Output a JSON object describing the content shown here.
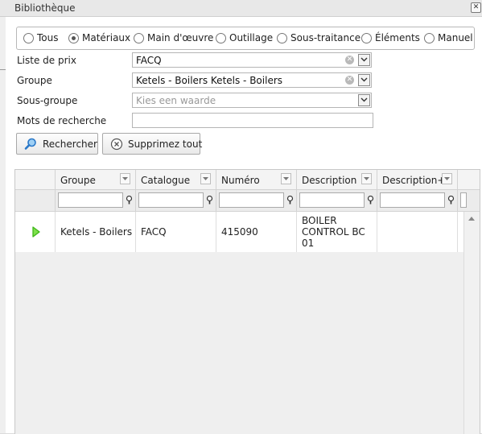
{
  "window": {
    "title": "Bibliothèque",
    "close_glyph": "✕"
  },
  "categories": [
    {
      "label": "Tous",
      "checked": false
    },
    {
      "label": "Matériaux",
      "checked": true
    },
    {
      "label": "Main d'œuvre",
      "checked": false
    },
    {
      "label": "Outillage",
      "checked": false
    },
    {
      "label": "Sous-traitance",
      "checked": false
    },
    {
      "label": "Éléments",
      "checked": false
    },
    {
      "label": "Manuel",
      "checked": false
    }
  ],
  "form": {
    "price_list": {
      "label": "Liste de prix",
      "value": "FACQ"
    },
    "group": {
      "label": "Groupe",
      "value": "Ketels - Boilers Ketels - Boilers"
    },
    "subgroup": {
      "label": "Sous-groupe",
      "placeholder": "Kies een waarde"
    },
    "keywords": {
      "label": "Mots de recherche",
      "value": ""
    }
  },
  "buttons": {
    "search": "Rechercher",
    "clear_all": "Supprimez tout"
  },
  "grid": {
    "columns": [
      "Groupe",
      "Catalogue",
      "Numéro",
      "Description",
      "Description+"
    ],
    "rows": [
      {
        "groupe": "Ketels - Boilers",
        "catalogue": "FACQ",
        "numero": "415090",
        "description": [
          "BOILER",
          "CONTROL BC",
          "01"
        ],
        "description_plus": ""
      }
    ]
  },
  "colors": {
    "play_icon": "#3fb618",
    "search_icon": "#2a78c8"
  }
}
